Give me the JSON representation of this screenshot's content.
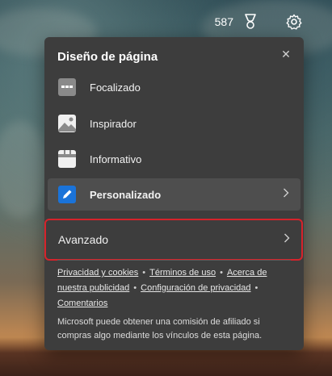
{
  "header": {
    "points": "587",
    "trophy_icon": "trophy-icon",
    "settings_icon": "gear-icon"
  },
  "panel": {
    "title": "Diseño de página",
    "close_icon": "close-icon",
    "options": [
      {
        "label": "Focalizado",
        "icon": "focused-layout-icon",
        "selected": false
      },
      {
        "label": "Inspirador",
        "icon": "image-icon",
        "selected": false
      },
      {
        "label": "Informativo",
        "icon": "informational-layout-icon",
        "selected": false
      },
      {
        "label": "Personalizado",
        "icon": "pencil-icon",
        "selected": true
      }
    ],
    "advanced": {
      "label": "Avanzado",
      "highlight_color": "#d6232b"
    },
    "links": [
      "Privacidad y cookies",
      "Términos de uso",
      "Acerca de nuestra publicidad",
      "Configuración de privacidad",
      "Comentarios"
    ],
    "disclaimer": "Microsoft puede obtener una comisión de afiliado si compras algo mediante los vínculos de esta página."
  },
  "colors": {
    "panel_bg": "#3d3d3d",
    "selected_bg": "#4e4e4e",
    "accent_blue": "#1a73d9"
  }
}
